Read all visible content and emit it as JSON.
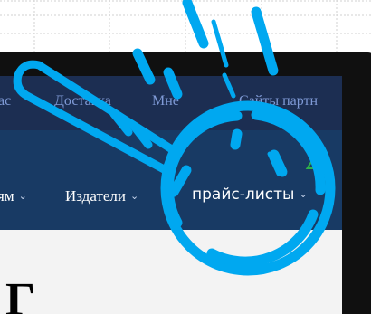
{
  "nav_top": {
    "items": [
      {
        "label": "ас"
      },
      {
        "label": "Доставка"
      },
      {
        "label": "Мне"
      },
      {
        "label": "Сайты партн"
      }
    ]
  },
  "nav_main": {
    "items": [
      {
        "label": "ям",
        "chevron": "⌄"
      },
      {
        "label": "Издатели",
        "chevron": "⌄"
      }
    ],
    "promo_label": "прайс-листы",
    "promo_chevron": "⌄"
  },
  "misc": {
    "green_mark": "∠",
    "content_char": "Г"
  },
  "colors": {
    "accent_cyan": "#00a8f0",
    "nav_top_bg": "#1c2e52",
    "nav_main_bg": "#183a64",
    "link_blue": "#7f9ad6",
    "green": "#2fb24a"
  },
  "icons": [
    "magnifier-icon",
    "motion-lines-icon"
  ]
}
